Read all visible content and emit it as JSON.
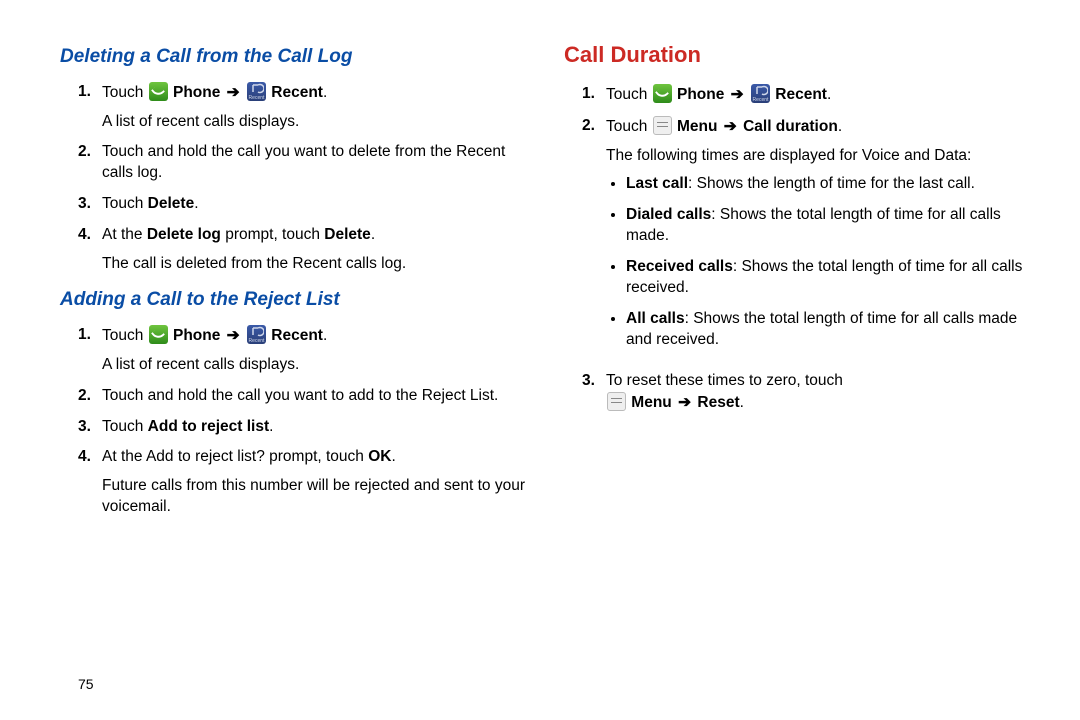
{
  "arrow": "➔",
  "pagenum": "75",
  "left": {
    "sec1": {
      "title": "Deleting a Call from the Call Log",
      "s1_a": "Touch ",
      "s1_b": " Phone ",
      "s1_c": " Recent",
      "s1_sub": "A list of recent calls displays.",
      "s2": "Touch and hold the call you want to delete from the Recent calls log.",
      "s3_a": "Touch ",
      "s3_b": "Delete",
      "s4_a": "At the ",
      "s4_b": "Delete log",
      "s4_c": " prompt, touch ",
      "s4_d": "Delete",
      "s4_sub": "The call is deleted from the Recent calls log."
    },
    "sec2": {
      "title": "Adding a Call to the Reject List",
      "s1_a": "Touch ",
      "s1_b": " Phone ",
      "s1_c": " Recent",
      "s1_sub": "A list of recent calls displays.",
      "s2": "Touch and hold the call you want to add to the Reject List.",
      "s3_a": "Touch ",
      "s3_b": "Add to reject list",
      "s4_a": "At the Add to reject list? prompt, touch ",
      "s4_b": "OK",
      "s4_sub": "Future calls from this number will be rejected and sent to your voicemail."
    }
  },
  "right": {
    "title": "Call Duration",
    "s1_a": "Touch ",
    "s1_b": " Phone ",
    "s1_c": " Recent",
    "s2_a": "Touch ",
    "s2_b": " Menu ",
    "s2_c": " Call duration",
    "s2_sub": "The following times are displayed for Voice and Data:",
    "b1_a": "Last call",
    "b1_b": ": Shows the length of time for the last call.",
    "b2_a": "Dialed calls",
    "b2_b": ": Shows the total length of time for all calls made.",
    "b3_a": "Received calls",
    "b3_b": ": Shows the total length of time for all calls received.",
    "b4_a": "All calls",
    "b4_b": ": Shows the total length of time for all calls made and received.",
    "s3_a": "To reset these times to zero, touch",
    "s3_b": " Menu ",
    "s3_c": " Reset"
  },
  "icons": {
    "recent_label": "Recent"
  }
}
